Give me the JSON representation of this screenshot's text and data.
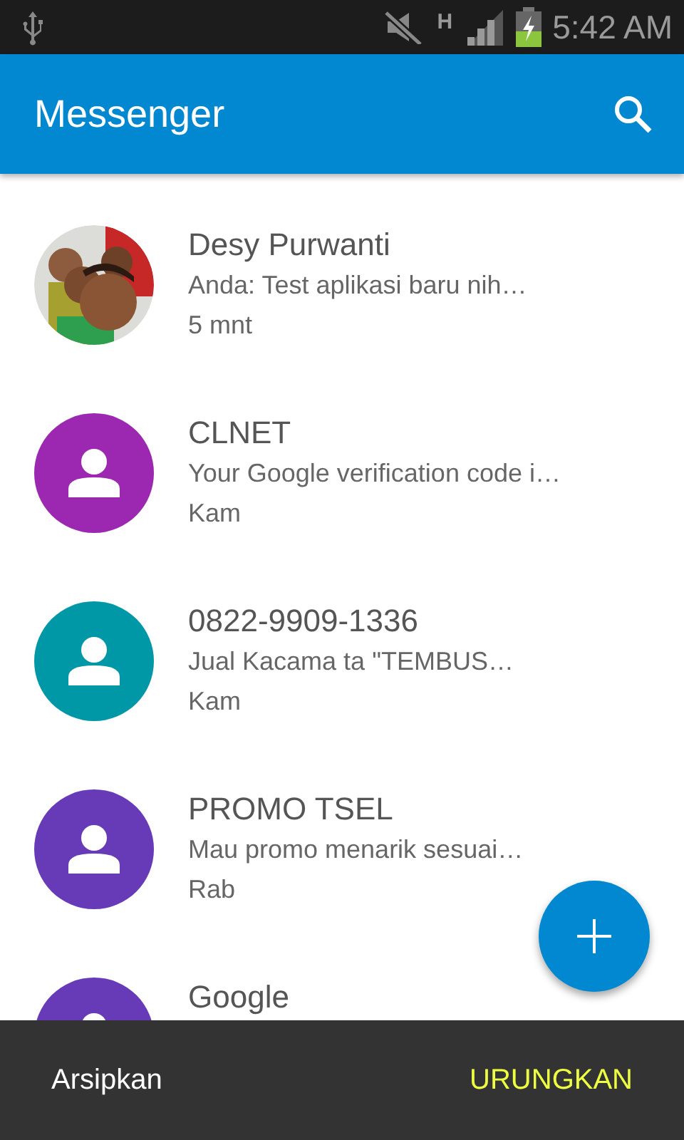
{
  "status_bar": {
    "network_type": "H",
    "time": "5:42 AM"
  },
  "app_bar": {
    "title": "Messenger"
  },
  "conversations": [
    {
      "kind": "picture",
      "name": "Desy Purwanti",
      "preview": "Anda: Test aplikasi baru nih…",
      "time": "5 mnt"
    },
    {
      "kind": "contact",
      "color": "#9c27b0",
      "name": "CLNET",
      "preview": "Your Google verification code i…",
      "time": "Kam"
    },
    {
      "kind": "contact",
      "color": "#0097a7",
      "name": "0822-9909-1336",
      "preview": "Jual Kacama ta \"TEMBUS…",
      "time": "Kam"
    },
    {
      "kind": "contact",
      "color": "#673ab7",
      "name": "PROMO TSEL",
      "preview": "Mau promo menarik sesuai…",
      "time": "Rab"
    },
    {
      "kind": "contact",
      "color": "#673ab7",
      "name": "Google"
    }
  ],
  "snackbar": {
    "message": "Arsipkan",
    "action": "URUNGKAN"
  }
}
